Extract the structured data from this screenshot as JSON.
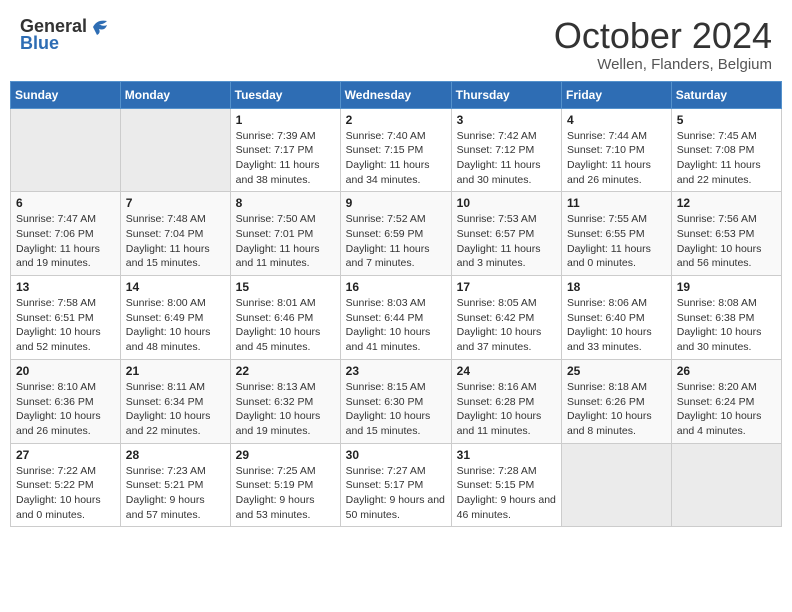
{
  "header": {
    "logo_general": "General",
    "logo_blue": "Blue",
    "title": "October 2024",
    "subtitle": "Wellen, Flanders, Belgium"
  },
  "weekdays": [
    "Sunday",
    "Monday",
    "Tuesday",
    "Wednesday",
    "Thursday",
    "Friday",
    "Saturday"
  ],
  "weeks": [
    [
      {
        "empty": true
      },
      {
        "empty": true
      },
      {
        "day": "1",
        "sunrise": "7:39 AM",
        "sunset": "7:17 PM",
        "daylight": "11 hours and 38 minutes."
      },
      {
        "day": "2",
        "sunrise": "7:40 AM",
        "sunset": "7:15 PM",
        "daylight": "11 hours and 34 minutes."
      },
      {
        "day": "3",
        "sunrise": "7:42 AM",
        "sunset": "7:12 PM",
        "daylight": "11 hours and 30 minutes."
      },
      {
        "day": "4",
        "sunrise": "7:44 AM",
        "sunset": "7:10 PM",
        "daylight": "11 hours and 26 minutes."
      },
      {
        "day": "5",
        "sunrise": "7:45 AM",
        "sunset": "7:08 PM",
        "daylight": "11 hours and 22 minutes."
      }
    ],
    [
      {
        "day": "6",
        "sunrise": "7:47 AM",
        "sunset": "7:06 PM",
        "daylight": "11 hours and 19 minutes."
      },
      {
        "day": "7",
        "sunrise": "7:48 AM",
        "sunset": "7:04 PM",
        "daylight": "11 hours and 15 minutes."
      },
      {
        "day": "8",
        "sunrise": "7:50 AM",
        "sunset": "7:01 PM",
        "daylight": "11 hours and 11 minutes."
      },
      {
        "day": "9",
        "sunrise": "7:52 AM",
        "sunset": "6:59 PM",
        "daylight": "11 hours and 7 minutes."
      },
      {
        "day": "10",
        "sunrise": "7:53 AM",
        "sunset": "6:57 PM",
        "daylight": "11 hours and 3 minutes."
      },
      {
        "day": "11",
        "sunrise": "7:55 AM",
        "sunset": "6:55 PM",
        "daylight": "11 hours and 0 minutes."
      },
      {
        "day": "12",
        "sunrise": "7:56 AM",
        "sunset": "6:53 PM",
        "daylight": "10 hours and 56 minutes."
      }
    ],
    [
      {
        "day": "13",
        "sunrise": "7:58 AM",
        "sunset": "6:51 PM",
        "daylight": "10 hours and 52 minutes."
      },
      {
        "day": "14",
        "sunrise": "8:00 AM",
        "sunset": "6:49 PM",
        "daylight": "10 hours and 48 minutes."
      },
      {
        "day": "15",
        "sunrise": "8:01 AM",
        "sunset": "6:46 PM",
        "daylight": "10 hours and 45 minutes."
      },
      {
        "day": "16",
        "sunrise": "8:03 AM",
        "sunset": "6:44 PM",
        "daylight": "10 hours and 41 minutes."
      },
      {
        "day": "17",
        "sunrise": "8:05 AM",
        "sunset": "6:42 PM",
        "daylight": "10 hours and 37 minutes."
      },
      {
        "day": "18",
        "sunrise": "8:06 AM",
        "sunset": "6:40 PM",
        "daylight": "10 hours and 33 minutes."
      },
      {
        "day": "19",
        "sunrise": "8:08 AM",
        "sunset": "6:38 PM",
        "daylight": "10 hours and 30 minutes."
      }
    ],
    [
      {
        "day": "20",
        "sunrise": "8:10 AM",
        "sunset": "6:36 PM",
        "daylight": "10 hours and 26 minutes."
      },
      {
        "day": "21",
        "sunrise": "8:11 AM",
        "sunset": "6:34 PM",
        "daylight": "10 hours and 22 minutes."
      },
      {
        "day": "22",
        "sunrise": "8:13 AM",
        "sunset": "6:32 PM",
        "daylight": "10 hours and 19 minutes."
      },
      {
        "day": "23",
        "sunrise": "8:15 AM",
        "sunset": "6:30 PM",
        "daylight": "10 hours and 15 minutes."
      },
      {
        "day": "24",
        "sunrise": "8:16 AM",
        "sunset": "6:28 PM",
        "daylight": "10 hours and 11 minutes."
      },
      {
        "day": "25",
        "sunrise": "8:18 AM",
        "sunset": "6:26 PM",
        "daylight": "10 hours and 8 minutes."
      },
      {
        "day": "26",
        "sunrise": "8:20 AM",
        "sunset": "6:24 PM",
        "daylight": "10 hours and 4 minutes."
      }
    ],
    [
      {
        "day": "27",
        "sunrise": "7:22 AM",
        "sunset": "5:22 PM",
        "daylight": "10 hours and 0 minutes."
      },
      {
        "day": "28",
        "sunrise": "7:23 AM",
        "sunset": "5:21 PM",
        "daylight": "9 hours and 57 minutes."
      },
      {
        "day": "29",
        "sunrise": "7:25 AM",
        "sunset": "5:19 PM",
        "daylight": "9 hours and 53 minutes."
      },
      {
        "day": "30",
        "sunrise": "7:27 AM",
        "sunset": "5:17 PM",
        "daylight": "9 hours and 50 minutes."
      },
      {
        "day": "31",
        "sunrise": "7:28 AM",
        "sunset": "5:15 PM",
        "daylight": "9 hours and 46 minutes."
      },
      {
        "empty": true
      },
      {
        "empty": true
      }
    ]
  ],
  "labels": {
    "sunrise": "Sunrise:",
    "sunset": "Sunset:",
    "daylight": "Daylight:"
  }
}
